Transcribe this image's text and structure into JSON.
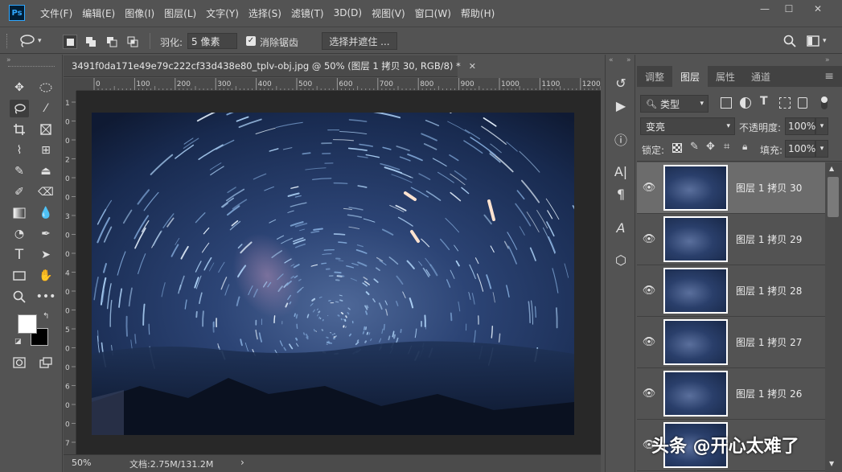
{
  "app": {
    "logo": "Ps"
  },
  "menu": [
    "文件(F)",
    "编辑(E)",
    "图像(I)",
    "图层(L)",
    "文字(Y)",
    "选择(S)",
    "滤镜(T)",
    "3D(D)",
    "视图(V)",
    "窗口(W)",
    "帮助(H)"
  ],
  "window_controls": {
    "minimize": "—",
    "maximize": "☐",
    "close": "✕"
  },
  "options": {
    "feather_label": "羽化:",
    "feather_value": "5 像素",
    "antialias_label": "消除锯齿",
    "antialias_checked": "✓",
    "select_mask_button": "选择并遮住 ..."
  },
  "document": {
    "tab_title": "3491f0da171e49e79c222cf33d438e80_tplv-obj.jpg @ 50% (图层 1 拷贝 30, RGB/8) *",
    "tab_close": "✕"
  },
  "ruler": {
    "h_ticks": [
      "0",
      "100",
      "200",
      "300",
      "400",
      "500",
      "600",
      "700",
      "800",
      "900",
      "1000",
      "1100",
      "1200"
    ],
    "v_ticks": [
      "1",
      "0",
      "0",
      "2",
      "0",
      "0",
      "3",
      "0",
      "0",
      "4",
      "0",
      "0",
      "5",
      "0",
      "0",
      "6",
      "0",
      "0",
      "7"
    ]
  },
  "status": {
    "zoom": "50%",
    "doc_info": "文档:2.75M/131.2M",
    "arrow": "›"
  },
  "panel": {
    "tabs": [
      "调整",
      "图层",
      "属性",
      "通道"
    ],
    "active_tab": "图层",
    "filter_kind": "类型",
    "blend_mode": "变亮",
    "opacity_label": "不透明度:",
    "opacity_value": "100%",
    "lock_label": "锁定:",
    "fill_label": "填充:",
    "fill_value": "100%",
    "menu_icon": "≡",
    "layers": [
      {
        "name": "图层 1 拷贝 30",
        "selected": true
      },
      {
        "name": "图层 1 拷贝 29",
        "selected": false
      },
      {
        "name": "图层 1 拷贝 28",
        "selected": false
      },
      {
        "name": "图层 1 拷贝 27",
        "selected": false
      },
      {
        "name": "图层 1 拷贝 26",
        "selected": false
      }
    ]
  },
  "watermark": "头条 @开心太难了",
  "colors": {
    "accent": "#31a8ff",
    "panel_bg": "#535353",
    "canvas_bg": "#282828",
    "sky": "#13213c"
  }
}
